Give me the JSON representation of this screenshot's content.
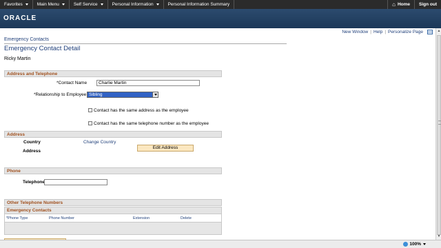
{
  "nav": {
    "items": [
      {
        "label": "Favorites",
        "menu": true
      },
      {
        "label": "Main Menu",
        "menu": true
      },
      {
        "label": "Self Service",
        "menu": true
      },
      {
        "label": "Personal Information",
        "menu": true
      },
      {
        "label": "Personal Information Summary",
        "menu": false
      }
    ],
    "home_label": "Home",
    "signout_label": "Sign out"
  },
  "banner": {
    "logo_text": "ORACLE"
  },
  "page_links": {
    "new_window": "New Window",
    "help": "Help",
    "personalize": "Personalize Page",
    "separator": "|"
  },
  "breadcrumb": "Emergency Contacts",
  "page_title": "Emergency Contact Detail",
  "employee_name": "Ricky Martin",
  "sections": {
    "address_telephone": "Address and Telephone",
    "address": "Address",
    "phone": "Phone",
    "other_numbers": "Other Telephone Numbers"
  },
  "form": {
    "contact_name_label": "*Contact Name",
    "contact_name_value": "Charlie Martin",
    "relationship_label": "*Relationship to Employee",
    "relationship_value": "Sibling",
    "same_address_label": "Contact has the same address as the employee",
    "same_address_checked": false,
    "same_phone_label": "Contact has the same telephone number as the employee",
    "same_phone_checked": false,
    "country_label": "Country",
    "change_country_link": "Change Country",
    "address_label": "Address",
    "edit_address_button": "Edit Address",
    "telephone_label": "Telephone",
    "telephone_value": ""
  },
  "grid": {
    "title": "Emergency Contacts",
    "columns": [
      "*Phone Type",
      "Phone Number",
      "Extension",
      "Delete"
    ]
  },
  "status": {
    "zoom": "100%"
  }
}
